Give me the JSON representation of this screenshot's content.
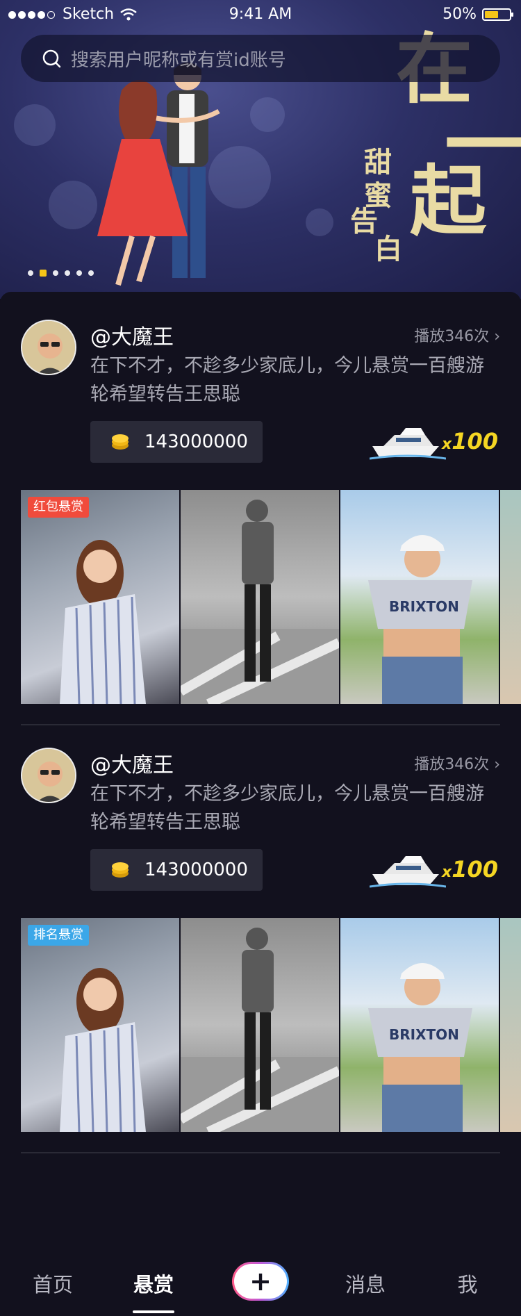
{
  "status_bar": {
    "carrier": "Sketch",
    "time": "9:41 AM",
    "battery": "50%",
    "battery_level": 0.5
  },
  "search": {
    "placeholder": "搜索用户昵称或有赏id账号"
  },
  "banner": {
    "headline_chars": [
      "在",
      "一",
      "起"
    ],
    "sub_left": [
      "告",
      "白"
    ],
    "sub_right": [
      "甜",
      "蜜"
    ],
    "pager": {
      "count": 6,
      "active_index": 1
    }
  },
  "posts": [
    {
      "username": "@大魔王",
      "plays": "播放346次",
      "description": "在下不才，不趁多少家底儿，今儿悬赏一百艘游轮希望转告王思聪",
      "coins": "143000000",
      "gift_icon": "yacht-icon",
      "gift_multiplier_prefix": "x",
      "gift_multiplier": "100",
      "tag": "红包悬赏",
      "tag_color": "#f04b3c"
    },
    {
      "username": "@大魔王",
      "plays": "播放346次",
      "description": "在下不才，不趁多少家底儿，今儿悬赏一百艘游轮希望转告王思聪",
      "coins": "143000000",
      "gift_icon": "yacht-icon",
      "gift_multiplier_prefix": "x",
      "gift_multiplier": "100",
      "tag": "排名悬赏",
      "tag_color": "#3ba7e8"
    }
  ],
  "tabbar": {
    "home": "首页",
    "reward": "悬赏",
    "plus": "+",
    "messages": "消息",
    "me": "我",
    "active": "reward"
  },
  "colors": {
    "background": "#12111e",
    "accent_gold": "#f5c518",
    "multiplier_yellow": "#f5d623"
  }
}
